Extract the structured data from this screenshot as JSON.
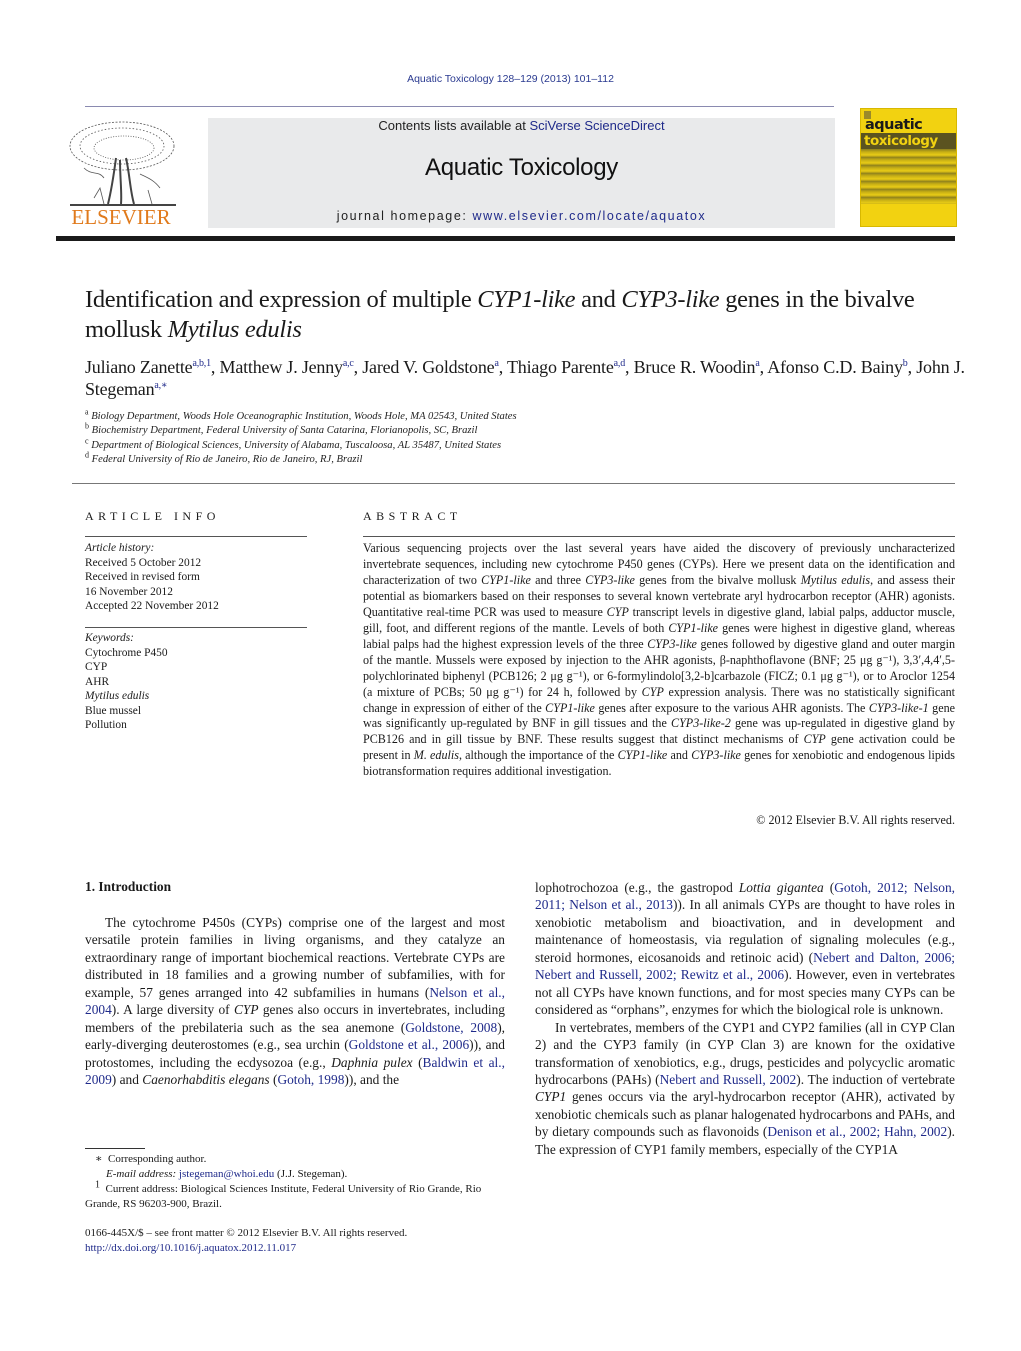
{
  "header": {
    "journal_ref": "Aquatic Toxicology 128–129 (2013) 101–112",
    "contents_prefix": "Contents lists available at ",
    "contents_link": "SciVerse ScienceDirect",
    "journal_title": "Aquatic Toxicology",
    "homepage_prefix": "journal homepage: ",
    "homepage_link": "www.elsevier.com/locate/aquatox",
    "publisher_logo_text": "ELSEVIER",
    "cover_line1": "aquatic",
    "cover_line2": "toxicology",
    "colors": {
      "link": "#1f2a8a",
      "publisher_orange": "#e07a1c",
      "cover_yellow": "#f2d211",
      "header_box": "#e9eaeb"
    }
  },
  "article": {
    "title_parts": [
      "Identification and expression of multiple ",
      "CYP1-like",
      " and ",
      "CYP3-like",
      " genes in the bivalve mollusk ",
      "Mytilus edulis"
    ],
    "authors": [
      {
        "name": "Juliano Zanette",
        "sup": "a,b,1",
        "sep": ", "
      },
      {
        "name": "Matthew J. Jenny",
        "sup": "a,c",
        "sep": ", "
      },
      {
        "name": "Jared V. Goldstone",
        "sup": "a",
        "sep": ", "
      },
      {
        "name": "Thiago Parente",
        "sup": "a,d",
        "sep": ", "
      },
      {
        "name": "Bruce R. Woodin",
        "sup": "a",
        "sep": ", "
      },
      {
        "name": "Afonso C.D. Bainy",
        "sup": "b",
        "sep": ", "
      },
      {
        "name": "John J. Stegeman",
        "sup": "a,∗",
        "sep": ""
      }
    ],
    "affiliations": [
      {
        "mark": "a",
        "text": "Biology Department, Woods Hole Oceanographic Institution, Woods Hole, MA 02543, United States"
      },
      {
        "mark": "b",
        "text": "Biochemistry Department, Federal University of Santa Catarina, Florianopolis, SC, Brazil"
      },
      {
        "mark": "c",
        "text": "Department of Biological Sciences, University of Alabama, Tuscaloosa, AL 35487, United States"
      },
      {
        "mark": "d",
        "text": "Federal University of Rio de Janeiro, Rio de Janeiro, RJ, Brazil"
      }
    ]
  },
  "article_info": {
    "heading": "ARTICLE INFO",
    "history_label": "Article history:",
    "history": [
      "Received 5 October 2012",
      "Received in revised form",
      "16 November 2012",
      "Accepted 22 November 2012"
    ],
    "keywords_label": "Keywords:",
    "keywords": [
      "Cytochrome P450",
      "CYP",
      "AHR",
      "Mytilus edulis",
      "Blue mussel",
      "Pollution"
    ]
  },
  "abstract": {
    "heading": "ABSTRACT",
    "segments": [
      {
        "t": "Various sequencing projects over the last several years have aided the discovery of previously uncharacterized invertebrate sequences, including new cytochrome P450 genes (CYPs). Here we present data on the identification and characterization of two "
      },
      {
        "t": "CYP1-like",
        "i": true
      },
      {
        "t": " and three "
      },
      {
        "t": "CYP3-like",
        "i": true
      },
      {
        "t": " genes from the bivalve mollusk "
      },
      {
        "t": "Mytilus edulis",
        "i": true
      },
      {
        "t": ", and assess their potential as biomarkers based on their responses to several known vertebrate aryl hydrocarbon receptor (AHR) agonists. Quantitative real-time PCR was used to measure "
      },
      {
        "t": "CYP",
        "i": true
      },
      {
        "t": " transcript levels in digestive gland, labial palps, adductor muscle, gill, foot, and different regions of the mantle. Levels of both "
      },
      {
        "t": "CYP1-like",
        "i": true
      },
      {
        "t": " genes were highest in digestive gland, whereas labial palps had the highest expression levels of the three "
      },
      {
        "t": "CYP3-like",
        "i": true
      },
      {
        "t": " genes followed by digestive gland and outer margin of the mantle. Mussels were exposed by injection to the AHR agonists, β-naphthoflavone (BNF; 25 μg g⁻¹), 3,3′,4,4′,5-polychlorinated biphenyl (PCB126; 2 μg g⁻¹), or 6-formylindolo[3,2-b]carbazole (FICZ; 0.1 μg g⁻¹), or to Aroclor 1254 (a mixture of PCBs; 50 μg g⁻¹) for 24 h, followed by "
      },
      {
        "t": "CYP",
        "i": true
      },
      {
        "t": " expression analysis. There was no statistically significant change in expression of either of the "
      },
      {
        "t": "CYP1-like",
        "i": true
      },
      {
        "t": " genes after exposure to the various AHR agonists. The "
      },
      {
        "t": "CYP3-like-1",
        "i": true
      },
      {
        "t": " gene was significantly up-regulated by BNF in gill tissues and the "
      },
      {
        "t": "CYP3-like-2",
        "i": true
      },
      {
        "t": " gene was up-regulated in digestive gland by PCB126 and in gill tissue by BNF. These results suggest that distinct mechanisms of "
      },
      {
        "t": "CYP",
        "i": true
      },
      {
        "t": " gene activation could be present in "
      },
      {
        "t": "M. edulis",
        "i": true
      },
      {
        "t": ", although the importance of the "
      },
      {
        "t": "CYP1-like",
        "i": true
      },
      {
        "t": " and "
      },
      {
        "t": "CYP3-like",
        "i": true
      },
      {
        "t": " genes for xenobiotic and endogenous lipids biotransformation requires additional investigation."
      }
    ],
    "copyright": "© 2012 Elsevier B.V. All rights reserved."
  },
  "body": {
    "section_heading": "1.  Introduction",
    "left_paragraph": [
      {
        "t": "The cytochrome P450s (CYPs) comprise one of the largest and most versatile protein families in living organisms, and they catalyze an extraordinary range of important biochemical reactions. Vertebrate CYPs are distributed in 18 families and a growing number of subfamilies, with for example, 57 genes arranged into 42 subfamilies in humans ("
      },
      {
        "t": "Nelson et al., 2004",
        "l": true
      },
      {
        "t": "). A large diversity of "
      },
      {
        "t": "CYP",
        "i": true
      },
      {
        "t": " genes also occurs in invertebrates, including members of the prebilateria such as the sea anemone ("
      },
      {
        "t": "Goldstone, 2008",
        "l": true
      },
      {
        "t": "), early-diverging deuterostomes (e.g., sea urchin ("
      },
      {
        "t": "Goldstone et al., 2006",
        "l": true
      },
      {
        "t": ")), and protostomes, including the ecdysozoa (e.g., "
      },
      {
        "t": "Daphnia pulex",
        "i": true
      },
      {
        "t": " ("
      },
      {
        "t": "Baldwin et al., 2009",
        "l": true
      },
      {
        "t": ") and "
      },
      {
        "t": "Caenorhabditis elegans",
        "i": true
      },
      {
        "t": " ("
      },
      {
        "t": "Gotoh, 1998",
        "l": true
      },
      {
        "t": ")), and the"
      }
    ],
    "right_paragraph_1": [
      {
        "t": "lophotrochozoa (e.g., the gastropod "
      },
      {
        "t": "Lottia gigantea",
        "i": true
      },
      {
        "t": " ("
      },
      {
        "t": "Gotoh, 2012; Nelson, 2011; Nelson et al., 2013",
        "l": true
      },
      {
        "t": ")). In all animals CYPs are thought to have roles in xenobiotic metabolism and bioactivation, and in development and maintenance of homeostasis, via regulation of signaling molecules (e.g., steroid hormones, eicosanoids and retinoic acid) ("
      },
      {
        "t": "Nebert and Dalton, 2006; Nebert and Russell, 2002; Rewitz et al., 2006",
        "l": true
      },
      {
        "t": "). However, even in vertebrates not all CYPs have known functions, and for most species many CYPs can be considered as “orphans”, enzymes for which the biological role is unknown."
      }
    ],
    "right_paragraph_2": [
      {
        "t": "In vertebrates, members of the CYP1 and CYP2 families (all in CYP Clan 2) and the CYP3 family (in CYP Clan 3) are known for the oxidative transformation of xenobiotics, e.g., drugs, pesticides and polycyclic aromatic hydrocarbons (PAHs) ("
      },
      {
        "t": "Nebert and Russell, 2002",
        "l": true
      },
      {
        "t": "). The induction of vertebrate "
      },
      {
        "t": "CYP1",
        "i": true
      },
      {
        "t": " genes occurs via the aryl-hydrocarbon receptor (AHR), activated by xenobiotic chemicals such as planar halogenated hydrocarbons and PAHs, and by dietary compounds such as flavonoids ("
      },
      {
        "t": "Denison et al., 2002; Hahn, 2002",
        "l": true
      },
      {
        "t": "). The expression of CYP1 family members, especially of the CYP1A"
      }
    ]
  },
  "footnotes": {
    "corresponding_mark": "∗",
    "corresponding_text": "Corresponding author.",
    "email_label": "E-mail address:",
    "email": "jstegeman@whoi.edu",
    "email_suffix": " (J.J. Stegeman).",
    "note1_mark": "1",
    "note1_text": "Current address: Biological Sciences Institute, Federal University of Rio Grande, Rio Grande, RS 96203-900, Brazil.",
    "front_matter": "0166-445X/$ – see front matter © 2012 Elsevier B.V. All rights reserved.",
    "doi": "http://dx.doi.org/10.1016/j.aquatox.2012.11.017"
  }
}
